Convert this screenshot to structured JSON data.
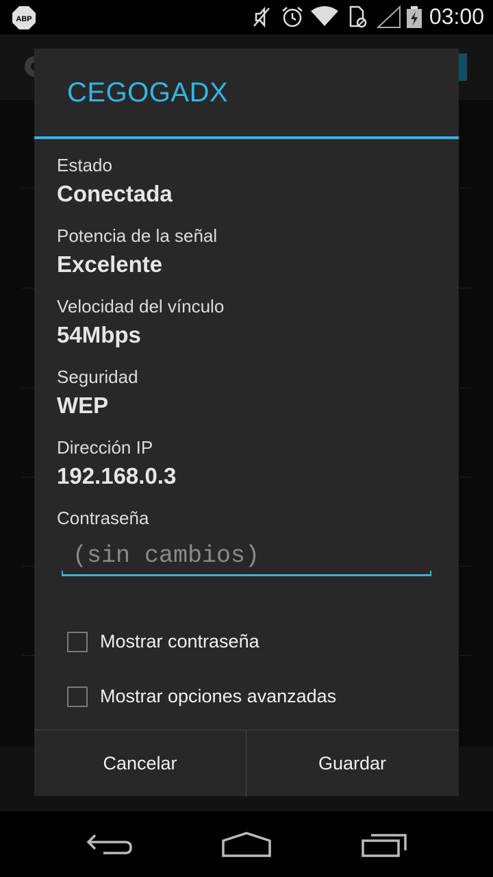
{
  "status_bar": {
    "time": "03:00",
    "icons": [
      "abp-icon",
      "mute-icon",
      "alarm-icon",
      "wifi-icon",
      "sim-icon",
      "signal-icon",
      "battery-icon"
    ],
    "abp_text": "ABP"
  },
  "dialog": {
    "title": "CEGOGADX",
    "fields": [
      {
        "label": "Estado",
        "value": "Conectada"
      },
      {
        "label": "Potencia de la señal",
        "value": "Excelente"
      },
      {
        "label": "Velocidad del vínculo",
        "value": "54Mbps"
      },
      {
        "label": "Seguridad",
        "value": "WEP"
      },
      {
        "label": "Dirección IP",
        "value": "192.168.0.3"
      }
    ],
    "password_label": "Contraseña",
    "password_placeholder": "(sin cambios)",
    "checkboxes": [
      {
        "label": "Mostrar contraseña",
        "checked": false
      },
      {
        "label": "Mostrar opciones avanzadas",
        "checked": false
      }
    ],
    "cancel_label": "Cancelar",
    "save_label": "Guardar"
  },
  "colors": {
    "accent": "#33b5e5",
    "dialog_bg": "#282828"
  },
  "navbar": {
    "icons": [
      "back-icon",
      "home-icon",
      "recents-icon"
    ]
  }
}
